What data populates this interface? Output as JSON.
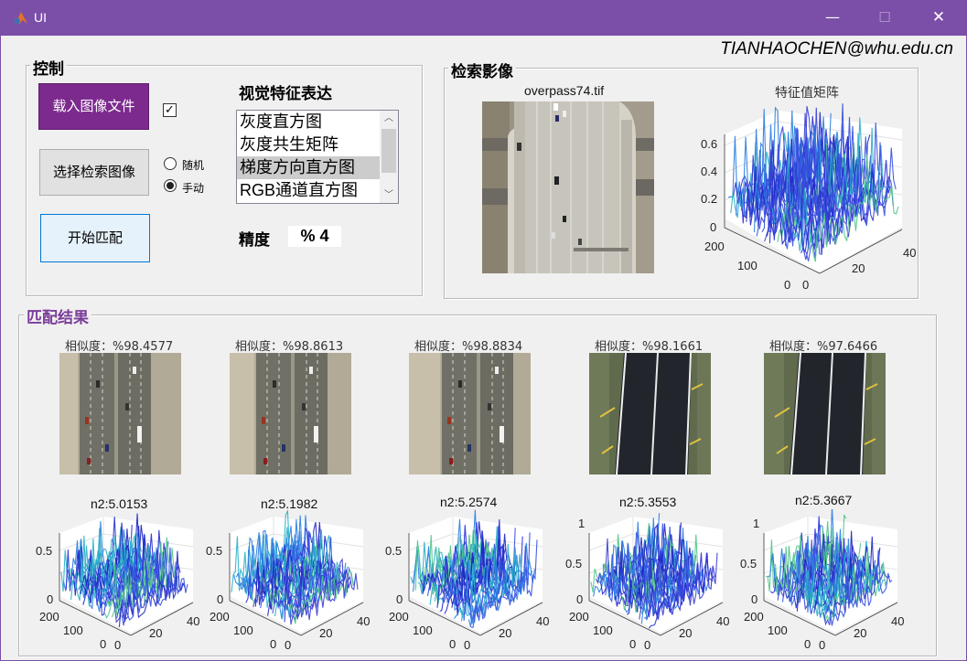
{
  "window": {
    "title": "UI",
    "minimize": "—",
    "maximize": "☐",
    "close": "✕"
  },
  "author": "TIANHAOCHEN@whu.edu.cn",
  "control": {
    "title": "控制",
    "load_button": "载入图像文件",
    "select_button": "选择检索图像",
    "start_button": "开始匹配",
    "checkbox_mark": "✓",
    "radio_random": "随机",
    "radio_manual": "手动",
    "feature_title": "视觉特征表达",
    "feature_options": [
      "灰度直方图",
      "灰度共生矩阵",
      "梯度方向直方图",
      "RGB通道直方图"
    ],
    "selected_feature": "梯度方向直方图",
    "accuracy_label": "精度",
    "accuracy_value": "% 4"
  },
  "retrieval": {
    "title": "检索影像",
    "image_title": "overpass74.tif",
    "plot_title": "特征值矩阵",
    "plot_z_ticks": [
      "0.6",
      "0.4",
      "0.2",
      "0"
    ],
    "plot_y_ticks": [
      "200",
      "100",
      "0"
    ],
    "plot_x_ticks": [
      "0",
      "20",
      "40"
    ]
  },
  "results": {
    "title": "匹配结果",
    "items": [
      {
        "similarity": "相似度：%98.4577",
        "n2": "n2:5.0153",
        "z_ticks": [
          "0.5",
          "0"
        ],
        "kind": "highway"
      },
      {
        "similarity": "相似度：%98.8613",
        "n2": "n2:5.1982",
        "z_ticks": [
          "0.5",
          "0"
        ],
        "kind": "highway"
      },
      {
        "similarity": "相似度：%98.8834",
        "n2": "n2:5.2574",
        "z_ticks": [
          "0.5",
          "0"
        ],
        "kind": "highway"
      },
      {
        "similarity": "相似度：%98.1661",
        "n2": "n2:5.3553",
        "z_ticks": [
          "1",
          "0.5",
          "0"
        ],
        "kind": "runway"
      },
      {
        "similarity": "相似度：%97.6466",
        "n2": "n2:5.3667",
        "z_ticks": [
          "1",
          "0.5",
          "0"
        ],
        "kind": "runway"
      }
    ],
    "y_ticks": [
      "200",
      "100",
      "0"
    ],
    "x_ticks": [
      "0",
      "20",
      "40"
    ]
  },
  "colors": {
    "titlebar": "#7b4ea8",
    "accent_button": "#7c2a8e",
    "result_title": "#7b3d9a"
  }
}
